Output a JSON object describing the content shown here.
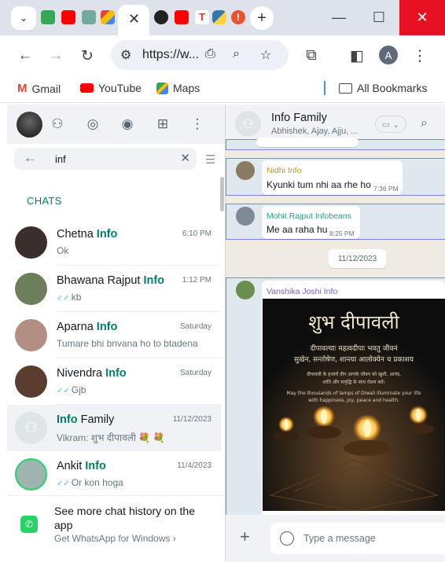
{
  "browser": {
    "address_text": "https://w...",
    "window_controls": {
      "minimize": "—",
      "maximize": "☐",
      "close": "✕"
    },
    "bookmarks": [
      {
        "label": "Gmail",
        "icon": "gmail-icon"
      },
      {
        "label": "YouTube",
        "icon": "youtube-icon"
      },
      {
        "label": "Maps",
        "icon": "maps-icon"
      }
    ],
    "all_bookmarks": "All Bookmarks",
    "profile_initial": "A"
  },
  "left": {
    "search_value": "inf",
    "section_label": "CHATS",
    "chats": [
      {
        "pre": "Chetna ",
        "match": "Info",
        "post": "",
        "time": "6:10 PM",
        "message": "Ok",
        "ticks": "",
        "avatar_color": "#3a2f2c"
      },
      {
        "pre": "Bhawana Rajput ",
        "match": "Info",
        "post": "",
        "time": "1:12 PM",
        "message": "kb",
        "ticks": "✓✓",
        "avatar_color": "#6d7f5a"
      },
      {
        "pre": "Aparna ",
        "match": "Info",
        "post": "",
        "time": "Saturday",
        "message": "Tumare bhi bnvana ho to btadena",
        "ticks": "",
        "avatar_color": "#b28e83"
      },
      {
        "pre": "Nivendra ",
        "match": "Info",
        "post": "",
        "time": "Saturday",
        "message": "Gjb",
        "ticks": "✓✓",
        "avatar_color": "#5b3d30"
      },
      {
        "pre": "",
        "match": "Info",
        "post": " Family",
        "time": "11/12/2023",
        "message": "Vikram: शुभ दीपावली 💐 💐",
        "ticks": "",
        "avatar_color": "#dfe5e7"
      },
      {
        "pre": "Ankit ",
        "match": "Info",
        "post": "",
        "time": "11/4/2023",
        "message": "Or kon hoga",
        "ticks": "✓✓",
        "avatar_color": "#9fb3b0"
      }
    ],
    "get_app_title": "See more chat history on the app",
    "get_app_link": "Get WhatsApp for Windows"
  },
  "right": {
    "group_name": "Info Family",
    "members": "Abhishek, Ajay, Ajju, ...",
    "messages": [
      {
        "sender": "Nidhi Info",
        "sender_color": "#c7931a",
        "text": "Kyunki tum nhi aa rhe ho",
        "time": "7:36 PM"
      },
      {
        "sender": "Mohit Rajput Infobeans",
        "sender_color": "#2f9e82",
        "text": "Me aa raha hu",
        "time": "8:25 PM"
      }
    ],
    "date_chip": "11/12/2023",
    "image_sender": "Vanshika Joshi Info",
    "image_sender_color": "#7b5fc0",
    "image_heading": "शुभ दीपावली",
    "image_line1": "दीपावल्याः महत्वदीपाः भवतु जीवनं",
    "image_line2": "सुखेन, सन्तोषेण, शान्त्या आलोक्येन च प्रकाशय",
    "image_line3": "दीपावली के हजारों दीप आपके जीवन को खुशी, आनंद,",
    "image_line4": "शांति और समृद्धि के साथ रोशन करें।",
    "image_line5": "May the thousands of lamps of Diwali illuminate your life",
    "image_line6": "with happiness, joy, peace and health.",
    "compose_placeholder": "Type a message"
  }
}
